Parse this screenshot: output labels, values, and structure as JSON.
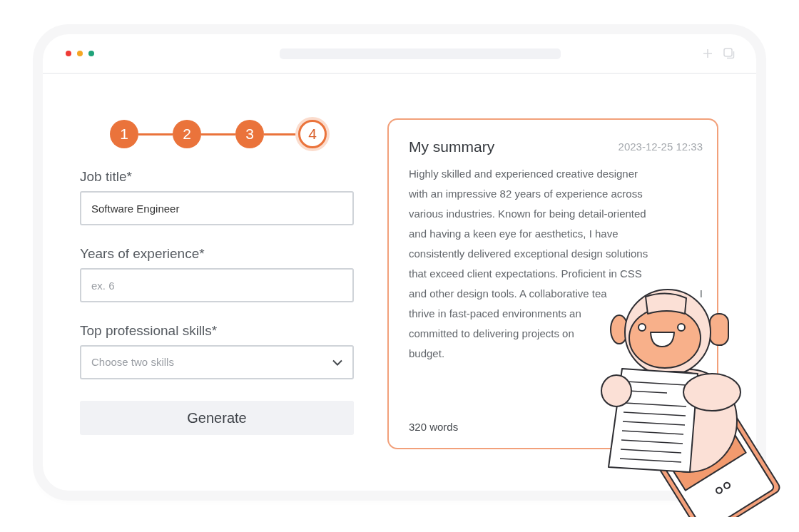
{
  "window": {
    "dots": [
      {
        "color": "#ef3b36"
      },
      {
        "color": "#f5a623"
      },
      {
        "color": "#1fa37a"
      }
    ]
  },
  "steps": [
    {
      "label": "1",
      "completed": true,
      "selected": false
    },
    {
      "label": "2",
      "completed": true,
      "selected": false
    },
    {
      "label": "3",
      "completed": true,
      "selected": false
    },
    {
      "label": "4",
      "completed": false,
      "selected": true
    }
  ],
  "form": {
    "fields": [
      {
        "kind": "text",
        "label": "Job title*",
        "value": "Software Engineer"
      },
      {
        "kind": "text",
        "label": "Years of experience*",
        "placeholder": "ex. 6"
      },
      {
        "kind": "select",
        "label": "Top professional skills*",
        "placeholder": "Choose two skills"
      }
    ],
    "button": "Generate"
  },
  "summary": {
    "title": "My summary",
    "timestamp": "2023-12-25 12:33",
    "lines": [
      {
        "text": "Highly skilled and experienced creative designer"
      },
      {
        "text": "with an impressive 82 years of experience across"
      },
      {
        "text": "various industries. Known for being detail-oriented"
      },
      {
        "text": "and having a keen eye for aesthetics, I have"
      },
      {
        "text": "consistently delivered exceptional design solutions"
      },
      {
        "text": "that exceed client expectations. Proficient in CSS"
      },
      {
        "text": "and other design tools. A collaborative tea",
        "tail": "I"
      },
      {
        "text": "thrive in fast-paced environments an"
      },
      {
        "text": "committed to delivering projects on"
      },
      {
        "text": "budget."
      }
    ],
    "word_count": "320 words"
  }
}
